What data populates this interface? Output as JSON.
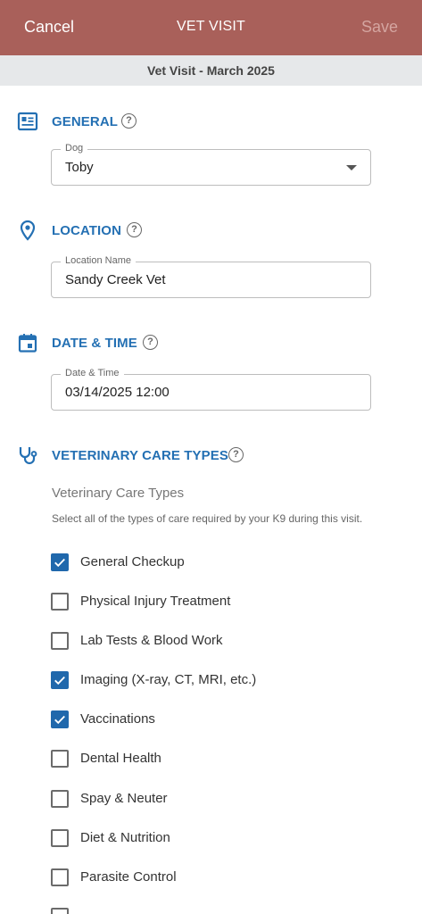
{
  "appbar": {
    "cancel_label": "Cancel",
    "title": "VET VISIT",
    "save_label": "Save"
  },
  "subheader": {
    "title": "Vet Visit - March 2025"
  },
  "sections": {
    "general": {
      "title": "GENERAL",
      "field_label": "Dog",
      "field_value": "Toby"
    },
    "location": {
      "title": "LOCATION",
      "field_label": "Location Name",
      "field_value": "Sandy Creek Vet"
    },
    "datetime": {
      "title": "DATE & TIME",
      "field_label": "Date & Time",
      "field_value": "03/14/2025 12:00"
    },
    "care": {
      "title": "VETERINARY CARE TYPES",
      "label": "Veterinary Care Types",
      "hint": "Select all of the types of care required by your K9 during this visit.",
      "options": [
        {
          "label": "General Checkup",
          "checked": true
        },
        {
          "label": "Physical Injury Treatment",
          "checked": false
        },
        {
          "label": "Lab Tests & Blood Work",
          "checked": false
        },
        {
          "label": "Imaging (X-ray, CT, MRI, etc.)",
          "checked": true
        },
        {
          "label": "Vaccinations",
          "checked": true
        },
        {
          "label": "Dental Health",
          "checked": false
        },
        {
          "label": "Spay & Neuter",
          "checked": false
        },
        {
          "label": "Diet & Nutrition",
          "checked": false
        },
        {
          "label": "Parasite Control",
          "checked": false
        }
      ]
    }
  },
  "help_glyph": "?",
  "colors": {
    "header": "#a9605a",
    "accent": "#2470b3",
    "checkbox_checked": "#2068ac"
  }
}
